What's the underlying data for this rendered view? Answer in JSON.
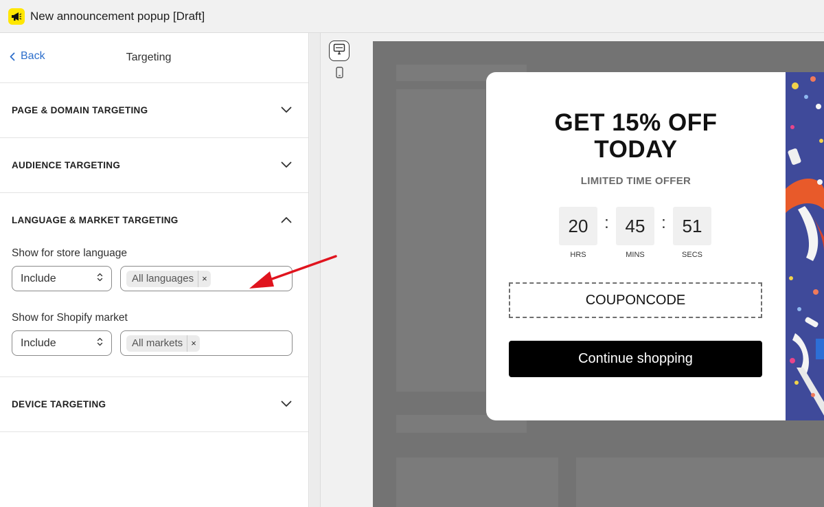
{
  "app": {
    "title": "New announcement popup [Draft]",
    "logo_icon": "megaphone-icon",
    "logo_color": "#ffe600"
  },
  "panel": {
    "back_label": "Back",
    "title": "Targeting",
    "sections": [
      {
        "title": "PAGE & DOMAIN TARGETING",
        "expanded": false
      },
      {
        "title": "AUDIENCE TARGETING",
        "expanded": false
      },
      {
        "title": "LANGUAGE & MARKET TARGETING",
        "expanded": true
      },
      {
        "title": "DEVICE TARGETING",
        "expanded": false
      }
    ],
    "language": {
      "label": "Show for store language",
      "mode": "Include",
      "tag": "All languages"
    },
    "market": {
      "label": "Show for Shopify market",
      "mode": "Include",
      "tag": "All markets"
    },
    "tag_remove": "×"
  },
  "popup": {
    "title_line1": "GET 15% OFF",
    "title_line2": "TODAY",
    "subtitle": "LIMITED TIME OFFER",
    "timer": {
      "hours": "20",
      "hours_label": "HRS",
      "minutes": "45",
      "minutes_label": "MINS",
      "seconds": "51",
      "seconds_label": "SECS",
      "separator": ":"
    },
    "coupon_code": "COUPONCODE",
    "cta_label": "Continue shopping"
  },
  "colors": {
    "accent_link": "#2c6ecb",
    "annotation_arrow": "#e0141e",
    "popup_image_bg": "#3f4a9a"
  }
}
